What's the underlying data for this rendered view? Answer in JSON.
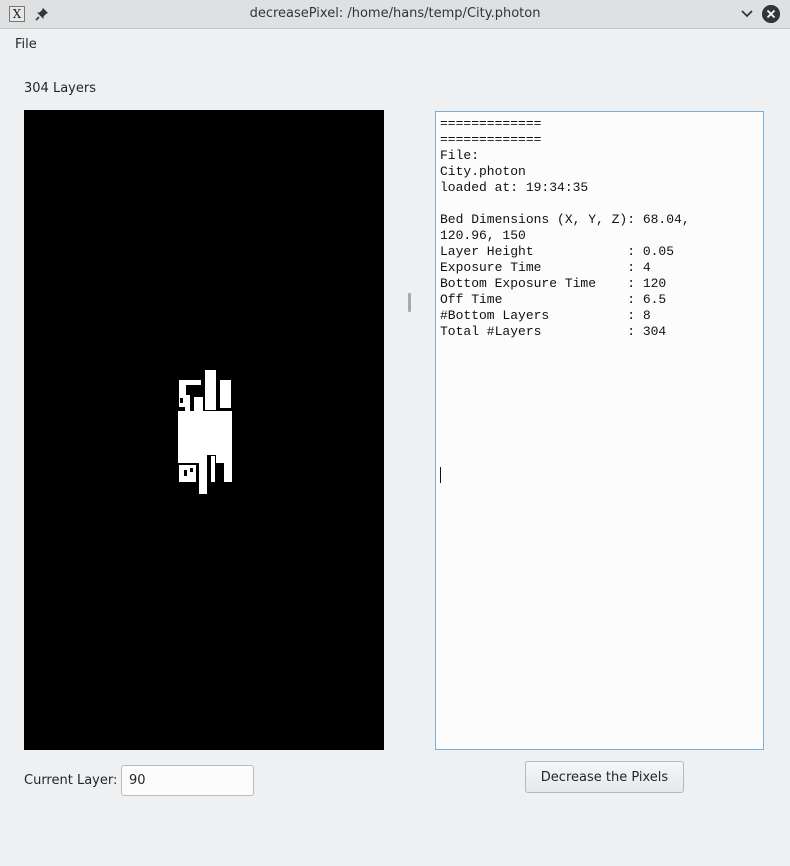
{
  "window": {
    "title": "decreasePixel: /home/hans/temp/City.photon",
    "app_icon_glyph": "X",
    "icons": [
      "app-icon",
      "pin-icon",
      "chevron-down-icon",
      "close-icon"
    ]
  },
  "menu": {
    "file_label": "File"
  },
  "layers_label": "304 Layers",
  "info_text": "=============\n=============\nFile:\nCity.photon\nloaded at: 19:34:35\n\nBed Dimensions (X, Y, Z): 68.04,\n120.96, 150\nLayer Height            : 0.05\nExposure Time           : 4\nBottom Exposure Time    : 120\nOff Time                : 6.5\n#Bottom Layers          : 8\nTotal #Layers           : 304\n",
  "current_layer": {
    "label": "Current Layer:",
    "value": "90"
  },
  "decrease_button_label": "Decrease the Pixels",
  "colors": {
    "preview_background": "#000000",
    "layer_pixels": "#ffffff",
    "focus_border": "#7ab0d8"
  }
}
